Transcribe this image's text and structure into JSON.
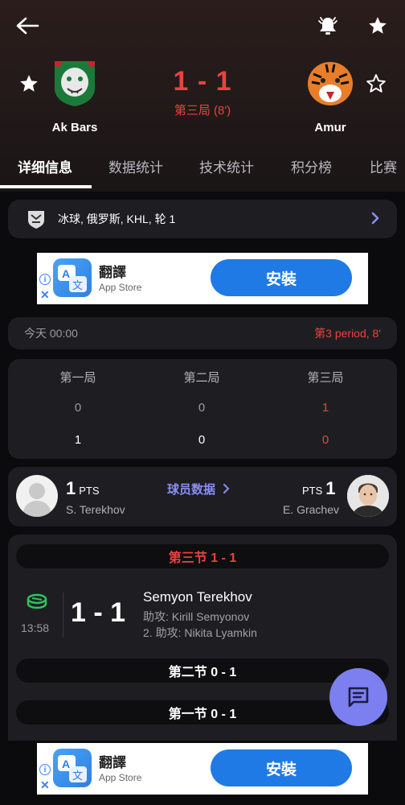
{
  "header": {
    "home": {
      "name": "Ak Bars"
    },
    "away": {
      "name": "Amur"
    },
    "score": "1 - 1",
    "period": "第三局 (8')"
  },
  "tabs": [
    "详细信息",
    "数据统计",
    "技术统计",
    "积分榜",
    "比赛"
  ],
  "league": {
    "text": "冰球, 俄罗斯, KHL, 轮 1"
  },
  "ad": {
    "title": "翻譯",
    "store": "App Store",
    "button": "安裝",
    "info": "i",
    "close": "✕"
  },
  "timebar": {
    "time": "今天 00:00",
    "period": "第3 period, 8'"
  },
  "periods": {
    "headers": [
      "第一局",
      "第二局",
      "第三局"
    ],
    "home": [
      "0",
      "0",
      "1"
    ],
    "away": [
      "1",
      "0",
      "0"
    ]
  },
  "players": {
    "home": {
      "pts": "1",
      "pts_label": "PTS",
      "name": "S. Terekhov"
    },
    "away": {
      "pts": "1",
      "pts_label": "PTS",
      "name": "E. Grachev"
    },
    "link": "球员数据"
  },
  "events": {
    "sections": [
      "第三节 1 - 1",
      "第二节 0 - 1",
      "第一节 0 - 1"
    ],
    "goal": {
      "time": "13:58",
      "score": "1 - 1",
      "scorer": "Semyon Terekhov",
      "assist1": "助攻: Kirill Semyonov",
      "assist2": "2. 助攻: Nikita Lyamkin"
    }
  },
  "colors": {
    "accent_red": "#e8433f",
    "accent_purple": "#7b7ff0",
    "card_bg": "#1e1e22"
  }
}
